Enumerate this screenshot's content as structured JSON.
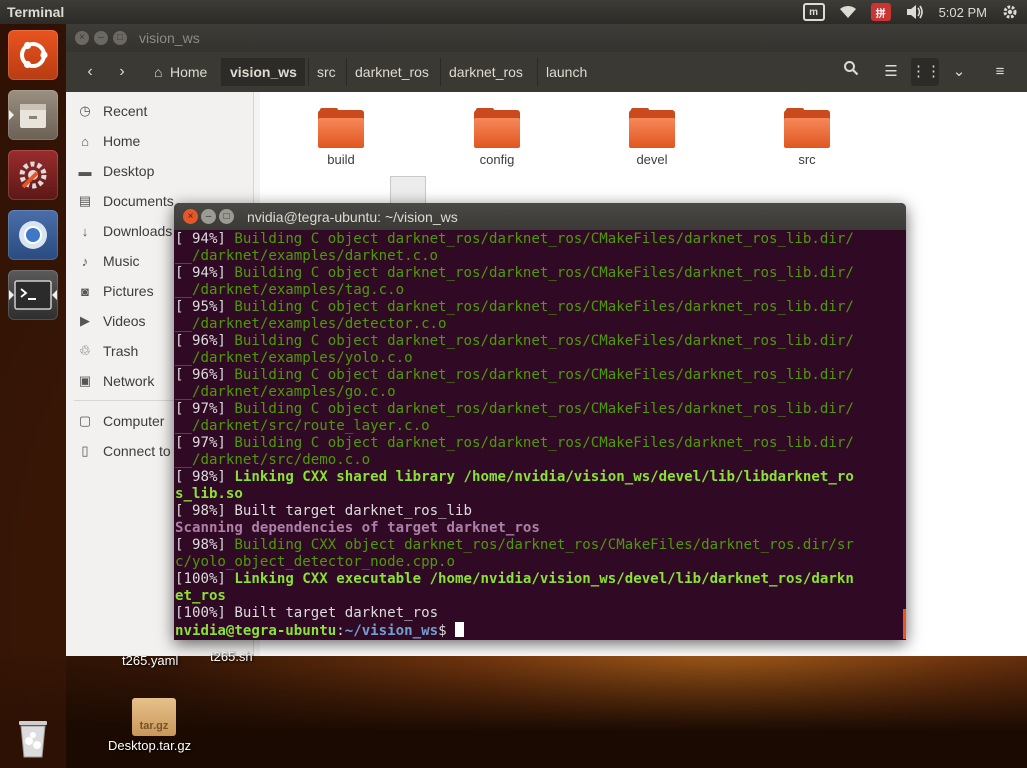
{
  "top_panel": {
    "app_title": "Terminal",
    "clock": "5:02 PM",
    "input_method": "拼",
    "keyboard": "m"
  },
  "launcher": {
    "items": [
      "ubuntu-dash",
      "files",
      "system-settings",
      "chromium",
      "terminal",
      "trash"
    ]
  },
  "files_window": {
    "title": "vision_ws",
    "breadcrumbs": [
      "Home",
      "vision_ws",
      "src",
      "darknet_ros",
      "darknet_ros",
      "launch"
    ],
    "sidebar": [
      {
        "icon": "clock-icon",
        "label": "Recent"
      },
      {
        "icon": "home-icon",
        "label": "Home"
      },
      {
        "icon": "folder-icon",
        "label": "Desktop"
      },
      {
        "icon": "document-icon",
        "label": "Documents"
      },
      {
        "icon": "download-icon",
        "label": "Downloads"
      },
      {
        "icon": "music-icon",
        "label": "Music"
      },
      {
        "icon": "camera-icon",
        "label": "Pictures"
      },
      {
        "icon": "video-icon",
        "label": "Videos"
      },
      {
        "icon": "trash-icon",
        "label": "Trash"
      },
      {
        "icon": "network-icon",
        "label": "Network"
      },
      {
        "icon": "computer-icon",
        "label": "Computer"
      },
      {
        "icon": "connect-icon",
        "label": "Connect to"
      }
    ],
    "folders": [
      "build",
      "config",
      "devel",
      "src"
    ]
  },
  "desktop": {
    "icons": [
      {
        "label": "t265.yaml"
      },
      {
        "label": "t265.sh"
      },
      {
        "label": "Desktop.tar.gz",
        "badge": "tar.gz"
      }
    ]
  },
  "terminal": {
    "title": "nvidia@tegra-ubuntu: ~/vision_ws",
    "lines": [
      {
        "prefix": "[ 94%] ",
        "text": "Building C object darknet_ros/darknet_ros/CMakeFiles/darknet_ros_lib.dir/",
        "style": "green"
      },
      {
        "prefix": "",
        "text": "__/darknet/examples/darknet.c.o",
        "style": "green"
      },
      {
        "prefix": "[ 94%] ",
        "text": "Building C object darknet_ros/darknet_ros/CMakeFiles/darknet_ros_lib.dir/",
        "style": "green"
      },
      {
        "prefix": "",
        "text": "__/darknet/examples/tag.c.o",
        "style": "green"
      },
      {
        "prefix": "[ 95%] ",
        "text": "Building C object darknet_ros/darknet_ros/CMakeFiles/darknet_ros_lib.dir/",
        "style": "green"
      },
      {
        "prefix": "",
        "text": "__/darknet/examples/detector.c.o",
        "style": "green"
      },
      {
        "prefix": "[ 96%] ",
        "text": "Building C object darknet_ros/darknet_ros/CMakeFiles/darknet_ros_lib.dir/",
        "style": "green"
      },
      {
        "prefix": "",
        "text": "__/darknet/examples/yolo.c.o",
        "style": "green"
      },
      {
        "prefix": "[ 96%] ",
        "text": "Building C object darknet_ros/darknet_ros/CMakeFiles/darknet_ros_lib.dir/",
        "style": "green"
      },
      {
        "prefix": "",
        "text": "__/darknet/examples/go.c.o",
        "style": "green"
      },
      {
        "prefix": "[ 97%] ",
        "text": "Building C object darknet_ros/darknet_ros/CMakeFiles/darknet_ros_lib.dir/",
        "style": "green"
      },
      {
        "prefix": "",
        "text": "__/darknet/src/route_layer.c.o",
        "style": "green"
      },
      {
        "prefix": "[ 97%] ",
        "text": "Building C object darknet_ros/darknet_ros/CMakeFiles/darknet_ros_lib.dir/",
        "style": "green"
      },
      {
        "prefix": "",
        "text": "__/darknet/src/demo.c.o",
        "style": "green"
      },
      {
        "prefix": "[ 98%] ",
        "text": "Linking CXX shared library /home/nvidia/vision_ws/devel/lib/libdarknet_ro",
        "style": "green-bold"
      },
      {
        "prefix": "",
        "text": "s_lib.so",
        "style": "green-bold"
      },
      {
        "prefix": "[ 98%] ",
        "text": "Built target darknet_ros_lib",
        "style": "plain"
      },
      {
        "prefix": "",
        "text": "Scanning dependencies of target darknet_ros",
        "style": "magenta-bold"
      },
      {
        "prefix": "[ 98%] ",
        "text": "Building CXX object darknet_ros/darknet_ros/CMakeFiles/darknet_ros.dir/sr",
        "style": "green"
      },
      {
        "prefix": "",
        "text": "c/yolo_object_detector_node.cpp.o",
        "style": "green"
      },
      {
        "prefix": "[100%] ",
        "text": "Linking CXX executable /home/nvidia/vision_ws/devel/lib/darknet_ros/darkn",
        "style": "green-bold"
      },
      {
        "prefix": "",
        "text": "et_ros",
        "style": "green-bold"
      },
      {
        "prefix": "[100%] ",
        "text": "Built target darknet_ros",
        "style": "plain"
      }
    ],
    "prompt_user": "nvidia@tegra-ubuntu",
    "prompt_sep": ":",
    "prompt_path": "~/vision_ws",
    "prompt_symbol": "$ "
  },
  "colors": {
    "terminal_bg": "#300a24",
    "accent": "#e95420",
    "green": "#4e9a06",
    "bright_green": "#8ae234"
  }
}
